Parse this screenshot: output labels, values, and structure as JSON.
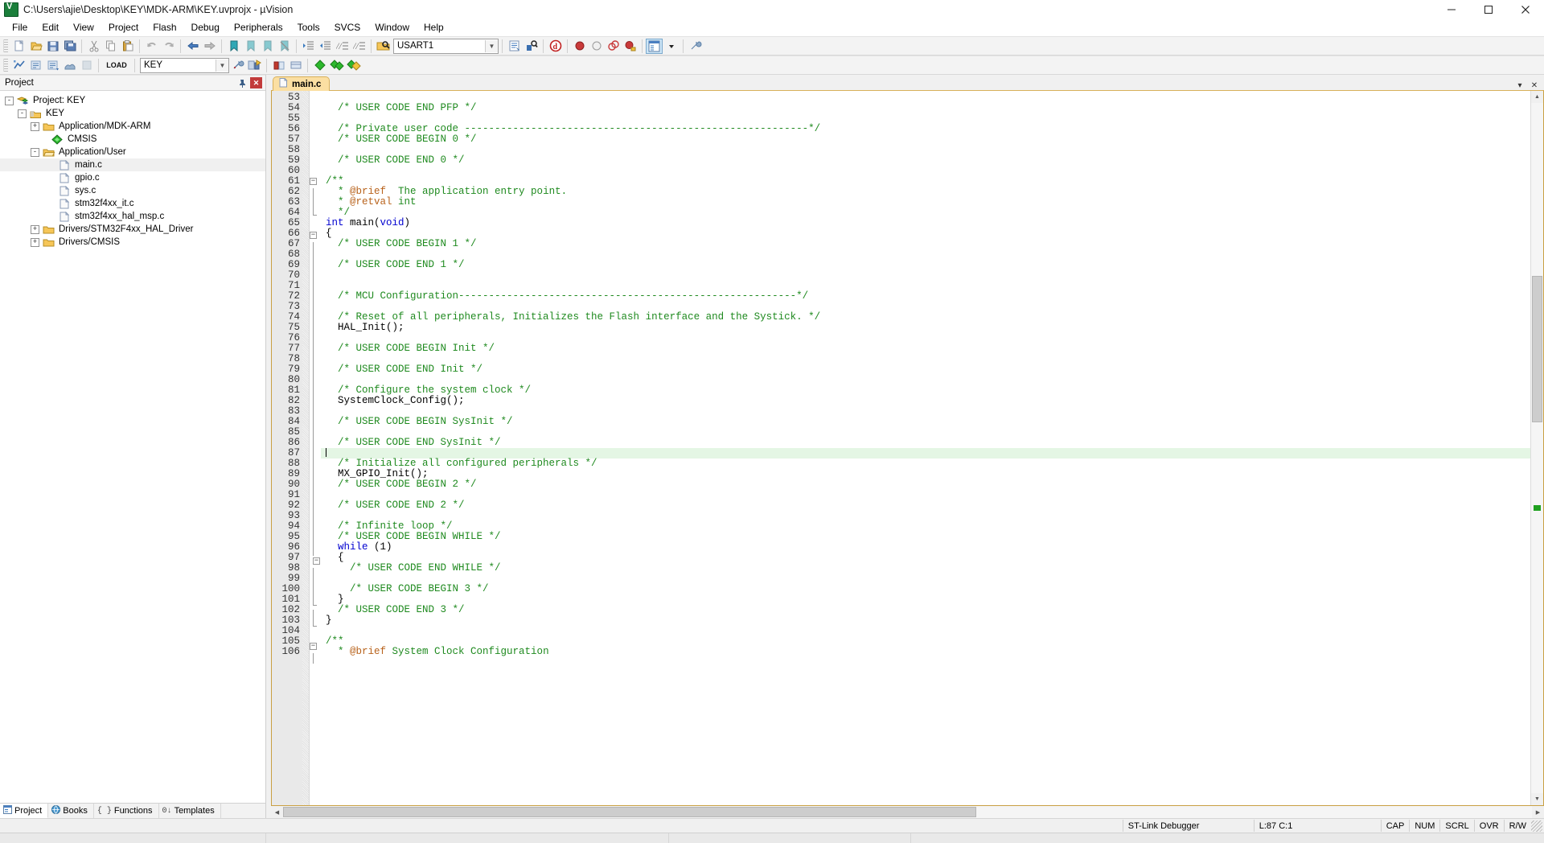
{
  "window": {
    "title": "C:\\Users\\ajie\\Desktop\\KEY\\MDK-ARM\\KEY.uvprojx - µVision",
    "app_icon": "uvision-icon",
    "minimize_label": "─",
    "maximize_label": "❐",
    "close_label": "✕"
  },
  "menu": [
    {
      "label": "File"
    },
    {
      "label": "Edit"
    },
    {
      "label": "View"
    },
    {
      "label": "Project"
    },
    {
      "label": "Flash"
    },
    {
      "label": "Debug"
    },
    {
      "label": "Peripherals"
    },
    {
      "label": "Tools"
    },
    {
      "label": "SVCS"
    },
    {
      "label": "Window"
    },
    {
      "label": "Help"
    }
  ],
  "toolbar1": {
    "target_combo_value": "USART1",
    "items": [
      {
        "name": "new-file-icon"
      },
      {
        "name": "open-file-icon"
      },
      {
        "name": "save-icon"
      },
      {
        "name": "save-all-icon"
      },
      {
        "name": "cut-icon"
      },
      {
        "name": "copy-icon"
      },
      {
        "name": "paste-icon"
      },
      {
        "name": "undo-icon"
      },
      {
        "name": "redo-icon"
      },
      {
        "name": "navigate-back-icon"
      },
      {
        "name": "navigate-forward-icon"
      },
      {
        "name": "bookmark-toggle-icon"
      },
      {
        "name": "bookmark-prev-icon"
      },
      {
        "name": "bookmark-next-icon"
      },
      {
        "name": "bookmark-clear-icon"
      },
      {
        "name": "indent-increase-icon"
      },
      {
        "name": "indent-decrease-icon"
      },
      {
        "name": "comment-icon"
      },
      {
        "name": "uncomment-icon"
      },
      {
        "name": "target-options-icon"
      },
      {
        "name": "file-extensions-icon"
      },
      {
        "name": "manage-project-items-icon"
      },
      {
        "name": "debug-session-icon"
      },
      {
        "name": "insert-breakpoint-icon"
      },
      {
        "name": "disable-breakpoint-icon"
      },
      {
        "name": "disable-all-breakpoints-icon"
      },
      {
        "name": "kill-all-breakpoints-icon"
      },
      {
        "name": "project-window-icon"
      },
      {
        "name": "configuration-wizard-icon"
      }
    ]
  },
  "toolbar2": {
    "target_combo_value": "KEY",
    "items": [
      {
        "name": "translate-icon"
      },
      {
        "name": "build-icon"
      },
      {
        "name": "rebuild-icon"
      },
      {
        "name": "batch-build-icon"
      },
      {
        "name": "stop-build-icon"
      },
      {
        "name": "load-icon",
        "text": "LOAD"
      },
      {
        "name": "target-options-icon"
      },
      {
        "name": "manage-run-time-env-icon"
      },
      {
        "name": "pack-installer-icon"
      },
      {
        "name": "svcs-commit-icon"
      },
      {
        "name": "svcs-update-icon"
      }
    ]
  },
  "project_panel": {
    "header_title": "Project",
    "auto_hide_icon": "pin-icon",
    "close_icon": "close-icon",
    "tree": [
      {
        "label": "Project: KEY",
        "depth": 0,
        "expander": "-",
        "icon": "project-icon",
        "selected": false
      },
      {
        "label": "KEY",
        "depth": 1,
        "expander": "-",
        "icon": "target-icon",
        "selected": false
      },
      {
        "label": "Application/MDK-ARM",
        "depth": 2,
        "expander": "+",
        "icon": "folder-closed-icon",
        "selected": false
      },
      {
        "label": "CMSIS",
        "depth": 2,
        "expander": "",
        "icon": "cmsis-icon",
        "selected": false
      },
      {
        "label": "Application/User",
        "depth": 2,
        "expander": "-",
        "icon": "folder-open-icon",
        "selected": false
      },
      {
        "label": "main.c",
        "depth": 3,
        "expander": "",
        "icon": "c-file-icon",
        "selected": true
      },
      {
        "label": "gpio.c",
        "depth": 3,
        "expander": "",
        "icon": "c-file-icon",
        "selected": false
      },
      {
        "label": "sys.c",
        "depth": 3,
        "expander": "",
        "icon": "c-file-icon",
        "selected": false
      },
      {
        "label": "stm32f4xx_it.c",
        "depth": 3,
        "expander": "",
        "icon": "c-file-icon",
        "selected": false
      },
      {
        "label": "stm32f4xx_hal_msp.c",
        "depth": 3,
        "expander": "",
        "icon": "c-file-icon",
        "selected": false
      },
      {
        "label": "Drivers/STM32F4xx_HAL_Driver",
        "depth": 2,
        "expander": "+",
        "icon": "folder-closed-icon",
        "selected": false
      },
      {
        "label": "Drivers/CMSIS",
        "depth": 2,
        "expander": "+",
        "icon": "folder-closed-icon",
        "selected": false
      }
    ],
    "bottom_tabs": [
      {
        "label": "Project",
        "icon": "project-tab-icon",
        "selected": true
      },
      {
        "label": "Books",
        "icon": "books-tab-icon",
        "selected": false
      },
      {
        "label": "Functions",
        "icon": "functions-tab-icon",
        "selected": false
      },
      {
        "label": "Templates",
        "icon": "templates-tab-icon",
        "selected": false
      }
    ]
  },
  "editor": {
    "tab": {
      "label": "main.c",
      "icon": "c-file-icon"
    },
    "tabstrip_menu_icon": "chevron-down-icon",
    "tabstrip_close_icon": "close-icon",
    "first_line": 53,
    "current_line": 87,
    "lines": [
      {
        "n": 53,
        "fold": "",
        "tokens": []
      },
      {
        "n": 54,
        "fold": "",
        "tokens": [
          {
            "t": "  /* USER CODE END PFP */",
            "c": "cmt"
          }
        ]
      },
      {
        "n": 55,
        "fold": "",
        "tokens": []
      },
      {
        "n": 56,
        "fold": "",
        "tokens": [
          {
            "t": "  /* Private user code ---------------------------------------------------------*/",
            "c": "cmt"
          }
        ]
      },
      {
        "n": 57,
        "fold": "",
        "tokens": [
          {
            "t": "  /* USER CODE BEGIN 0 */",
            "c": "cmt"
          }
        ]
      },
      {
        "n": 58,
        "fold": "",
        "tokens": []
      },
      {
        "n": 59,
        "fold": "",
        "tokens": [
          {
            "t": "  /* USER CODE END 0 */",
            "c": "cmt"
          }
        ]
      },
      {
        "n": 60,
        "fold": "",
        "tokens": []
      },
      {
        "n": 61,
        "fold": "box-start",
        "tokens": [
          {
            "t": "/**",
            "c": "cmt"
          }
        ]
      },
      {
        "n": 62,
        "fold": "line",
        "tokens": [
          {
            "t": "  * ",
            "c": "cmt"
          },
          {
            "t": "@brief",
            "c": "doc"
          },
          {
            "t": "  The application entry point.",
            "c": "cmt"
          }
        ]
      },
      {
        "n": 63,
        "fold": "line",
        "tokens": [
          {
            "t": "  * ",
            "c": "cmt"
          },
          {
            "t": "@retval",
            "c": "doc"
          },
          {
            "t": " int",
            "c": "cmt"
          }
        ]
      },
      {
        "n": 64,
        "fold": "end",
        "tokens": [
          {
            "t": "  */",
            "c": "cmt"
          }
        ]
      },
      {
        "n": 65,
        "fold": "",
        "tokens": [
          {
            "t": "int",
            "c": "kw"
          },
          {
            "t": " main(",
            "c": "id"
          },
          {
            "t": "void",
            "c": "kw"
          },
          {
            "t": ")",
            "c": "id"
          }
        ]
      },
      {
        "n": 66,
        "fold": "box-start",
        "tokens": [
          {
            "t": "{",
            "c": "id"
          }
        ]
      },
      {
        "n": 67,
        "fold": "line",
        "tokens": [
          {
            "t": "  /* USER CODE BEGIN 1 */",
            "c": "cmt"
          }
        ]
      },
      {
        "n": 68,
        "fold": "line",
        "tokens": []
      },
      {
        "n": 69,
        "fold": "line",
        "tokens": [
          {
            "t": "  /* USER CODE END 1 */",
            "c": "cmt"
          }
        ]
      },
      {
        "n": 70,
        "fold": "line",
        "tokens": []
      },
      {
        "n": 71,
        "fold": "line",
        "tokens": []
      },
      {
        "n": 72,
        "fold": "line",
        "tokens": [
          {
            "t": "  /* MCU Configuration--------------------------------------------------------*/",
            "c": "cmt"
          }
        ]
      },
      {
        "n": 73,
        "fold": "line",
        "tokens": []
      },
      {
        "n": 74,
        "fold": "line",
        "tokens": [
          {
            "t": "  /* Reset of all peripherals, Initializes the Flash interface and the Systick. */",
            "c": "cmt"
          }
        ]
      },
      {
        "n": 75,
        "fold": "line",
        "tokens": [
          {
            "t": "  HAL_Init();",
            "c": "id"
          }
        ]
      },
      {
        "n": 76,
        "fold": "line",
        "tokens": []
      },
      {
        "n": 77,
        "fold": "line",
        "tokens": [
          {
            "t": "  /* USER CODE BEGIN Init */",
            "c": "cmt"
          }
        ]
      },
      {
        "n": 78,
        "fold": "line",
        "tokens": []
      },
      {
        "n": 79,
        "fold": "line",
        "tokens": [
          {
            "t": "  /* USER CODE END Init */",
            "c": "cmt"
          }
        ]
      },
      {
        "n": 80,
        "fold": "line",
        "tokens": []
      },
      {
        "n": 81,
        "fold": "line",
        "tokens": [
          {
            "t": "  /* Configure the system clock */",
            "c": "cmt"
          }
        ]
      },
      {
        "n": 82,
        "fold": "line",
        "tokens": [
          {
            "t": "  SystemClock_Config();",
            "c": "id"
          }
        ]
      },
      {
        "n": 83,
        "fold": "line",
        "tokens": []
      },
      {
        "n": 84,
        "fold": "line",
        "tokens": [
          {
            "t": "  /* USER CODE BEGIN SysInit */",
            "c": "cmt"
          }
        ]
      },
      {
        "n": 85,
        "fold": "line",
        "tokens": []
      },
      {
        "n": 86,
        "fold": "line",
        "tokens": [
          {
            "t": "  /* USER CODE END SysInit */",
            "c": "cmt"
          }
        ]
      },
      {
        "n": 87,
        "fold": "line",
        "tokens": [],
        "current": true
      },
      {
        "n": 88,
        "fold": "line",
        "tokens": [
          {
            "t": "  /* Initialize all configured peripherals */",
            "c": "cmt"
          }
        ]
      },
      {
        "n": 89,
        "fold": "line",
        "tokens": [
          {
            "t": "  MX_GPIO_Init();",
            "c": "id"
          }
        ]
      },
      {
        "n": 90,
        "fold": "line",
        "tokens": [
          {
            "t": "  /* USER CODE BEGIN 2 */",
            "c": "cmt"
          }
        ]
      },
      {
        "n": 91,
        "fold": "line",
        "tokens": []
      },
      {
        "n": 92,
        "fold": "line",
        "tokens": [
          {
            "t": "  /* USER CODE END 2 */",
            "c": "cmt"
          }
        ]
      },
      {
        "n": 93,
        "fold": "line",
        "tokens": []
      },
      {
        "n": 94,
        "fold": "line",
        "tokens": [
          {
            "t": "  /* Infinite loop */",
            "c": "cmt"
          }
        ]
      },
      {
        "n": 95,
        "fold": "line",
        "tokens": [
          {
            "t": "  /* USER CODE BEGIN WHILE */",
            "c": "cmt"
          }
        ]
      },
      {
        "n": 96,
        "fold": "line",
        "tokens": [
          {
            "t": "  while",
            "c": "kw"
          },
          {
            "t": " (",
            "c": "id"
          },
          {
            "t": "1",
            "c": "id"
          },
          {
            "t": ")",
            "c": "id"
          }
        ]
      },
      {
        "n": 97,
        "fold": "box-inner",
        "tokens": [
          {
            "t": "  {",
            "c": "id"
          }
        ]
      },
      {
        "n": 98,
        "fold": "line",
        "tokens": [
          {
            "t": "    /* USER CODE END WHILE */",
            "c": "cmt"
          }
        ]
      },
      {
        "n": 99,
        "fold": "line",
        "tokens": []
      },
      {
        "n": 100,
        "fold": "line",
        "tokens": [
          {
            "t": "    /* USER CODE BEGIN 3 */",
            "c": "cmt"
          }
        ]
      },
      {
        "n": 101,
        "fold": "end-inner",
        "tokens": [
          {
            "t": "  }",
            "c": "id"
          }
        ]
      },
      {
        "n": 102,
        "fold": "line",
        "tokens": [
          {
            "t": "  /* USER CODE END 3 */",
            "c": "cmt"
          }
        ]
      },
      {
        "n": 103,
        "fold": "end",
        "tokens": [
          {
            "t": "}",
            "c": "id"
          }
        ]
      },
      {
        "n": 104,
        "fold": "",
        "tokens": []
      },
      {
        "n": 105,
        "fold": "box-start",
        "tokens": [
          {
            "t": "/**",
            "c": "cmt"
          }
        ]
      },
      {
        "n": 106,
        "fold": "line",
        "tokens": [
          {
            "t": "  * ",
            "c": "cmt"
          },
          {
            "t": "@brief",
            "c": "doc"
          },
          {
            "t": " System Clock Configuration",
            "c": "cmt"
          }
        ]
      }
    ]
  },
  "statusbar": {
    "debugger": "ST-Link Debugger",
    "position": "L:87 C:1",
    "cap": "CAP",
    "num": "NUM",
    "scrl": "SCRL",
    "ovr": "OVR",
    "rw": "R/W"
  },
  "colors": {
    "comment_green": "#1f8a1f",
    "keyword_blue": "#0000d0",
    "doc_tag_orange": "#b8621b",
    "current_line_bg": "#e4f6e4",
    "tab_active_bg": "#fbdfa2",
    "tab_border": "#c9a043"
  }
}
